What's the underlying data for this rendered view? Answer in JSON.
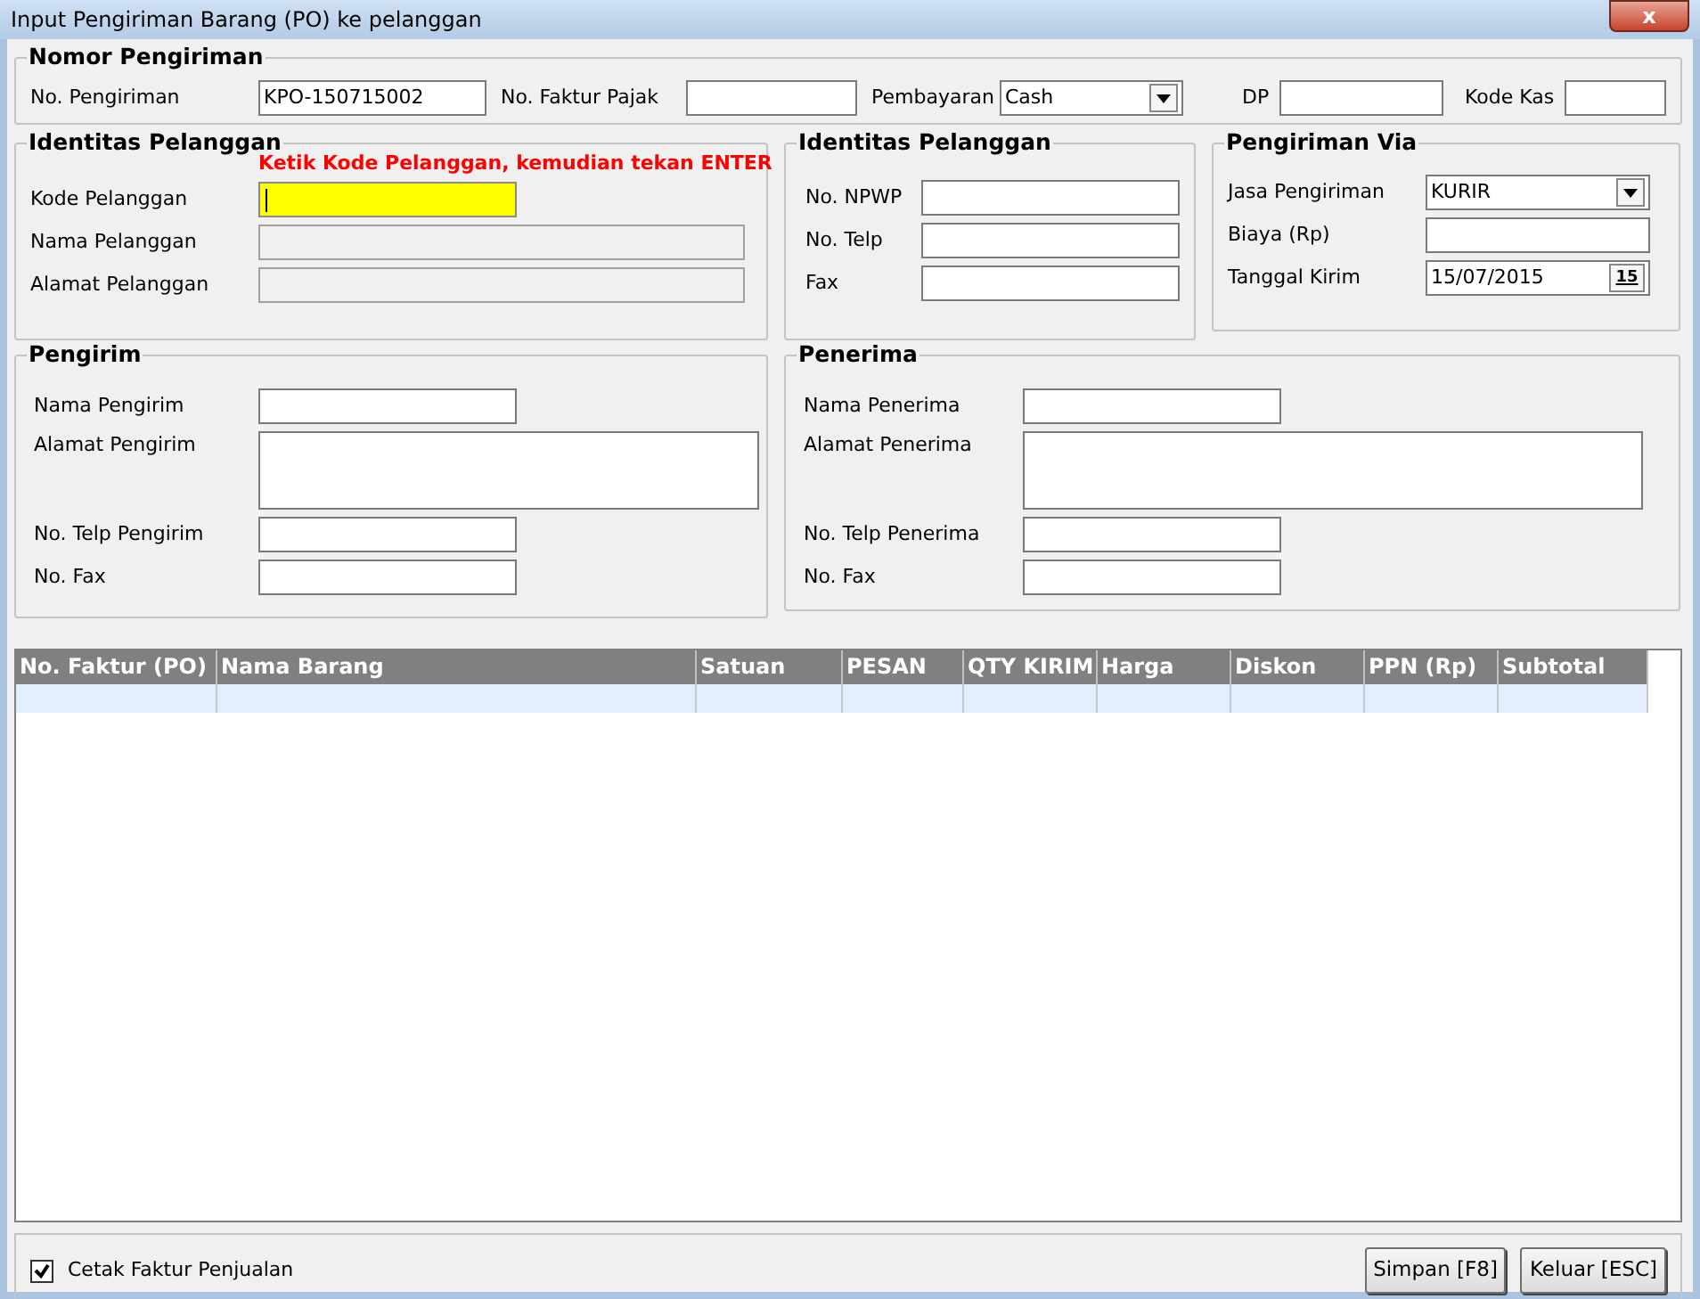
{
  "window": {
    "title": "Input Pengiriman Barang (PO) ke pelanggan",
    "close": "x"
  },
  "nomor_pengiriman": {
    "legend": "Nomor Pengiriman",
    "fields": [
      {
        "label": "No. Pengiriman",
        "kind": "text",
        "value": "KPO-150715002"
      },
      {
        "label": "No. Faktur Pajak",
        "kind": "text"
      },
      {
        "label": "Pembayaran",
        "kind": "dropdown",
        "value": "Cash"
      },
      {
        "label": "DP",
        "kind": "text"
      },
      {
        "label": "Kode Kas",
        "kind": "text"
      }
    ]
  },
  "identitas_pelanggan": {
    "legend": "Identitas Pelanggan",
    "hint": "Ketik Kode Pelanggan, kemudian tekan ENTER",
    "fields": [
      {
        "label": "Kode Pelanggan",
        "kind": "text",
        "focused": true,
        "disabled": false
      },
      {
        "label": "Nama Pelanggan",
        "kind": "text",
        "focused": false,
        "disabled": true
      },
      {
        "label": "Alamat Pelanggan",
        "kind": "text",
        "focused": false,
        "disabled": true
      }
    ]
  },
  "identitas_pelanggan_2": {
    "legend": "Identitas Pelanggan",
    "fields": [
      {
        "label": "No. NPWP",
        "kind": "text"
      },
      {
        "label": "No. Telp",
        "kind": "text"
      },
      {
        "label": "Fax",
        "kind": "text"
      }
    ]
  },
  "pengiriman_via": {
    "legend": "Pengiriman Via",
    "fields": [
      {
        "label": "Jasa Pengiriman",
        "kind": "dropdown",
        "value": "KURIR"
      },
      {
        "label": "Biaya (Rp)",
        "kind": "text"
      },
      {
        "label": "Tanggal Kirim",
        "kind": "date",
        "value": "15/07/2015",
        "button": "15"
      }
    ]
  },
  "pengirim": {
    "legend": "Pengirim",
    "fields": [
      {
        "label": "Nama Pengirim",
        "kind": "text"
      },
      {
        "label": "Alamat Pengirim",
        "kind": "textarea"
      },
      {
        "label": "No. Telp Pengirim",
        "kind": "text"
      },
      {
        "label": "No. Fax",
        "kind": "text"
      }
    ]
  },
  "penerima": {
    "legend": "Penerima",
    "fields": [
      {
        "label": "Nama Penerima",
        "kind": "text"
      },
      {
        "label": "Alamat Penerima",
        "kind": "textarea"
      },
      {
        "label": "No. Telp Penerima",
        "kind": "text"
      },
      {
        "label": "No. Fax",
        "kind": "text"
      }
    ]
  },
  "table": {
    "columns": [
      "No. Faktur (PO)",
      "Nama Barang",
      "Satuan",
      "PESAN",
      "QTY KIRIM",
      "Harga",
      "Diskon",
      "PPN (Rp)",
      "Subtotal"
    ]
  },
  "footer": {
    "checkbox": {
      "label": "Cetak Faktur Penjualan",
      "checked": true
    },
    "buttons": [
      "Simpan [F8]",
      "Keluar [ESC]"
    ]
  }
}
